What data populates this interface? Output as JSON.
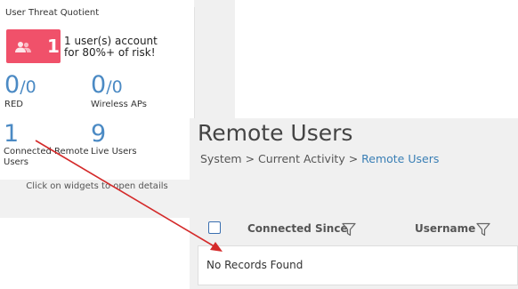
{
  "dashboard": {
    "uqt_title": "User Threat Quotient",
    "risk": {
      "count": "1",
      "line1": "1 user(s) account",
      "line2": "for 80%+ of risk!"
    },
    "red": {
      "value": "0",
      "total": "/0",
      "label": "RED"
    },
    "wireless": {
      "value": "0",
      "total": "/0",
      "label": "Wireless APs"
    },
    "connected": {
      "value": "1",
      "label_line1": "Connected Remote",
      "label_line2": "Users"
    },
    "live": {
      "value": "9",
      "label": "Live Users"
    },
    "hint": "Click on widgets to open details"
  },
  "remote_users": {
    "title": "Remote Users",
    "breadcrumb": {
      "part1": "System",
      "sep1": " > ",
      "part2": "Current Activity",
      "sep2": " > ",
      "current": "Remote Users"
    },
    "columns": [
      "Connected Since",
      "Username"
    ],
    "empty_message": "No Records Found"
  },
  "colors": {
    "accent_blue": "#4b8ac4",
    "risk_red": "#f0516a",
    "arrow_red": "#d42a2a"
  }
}
